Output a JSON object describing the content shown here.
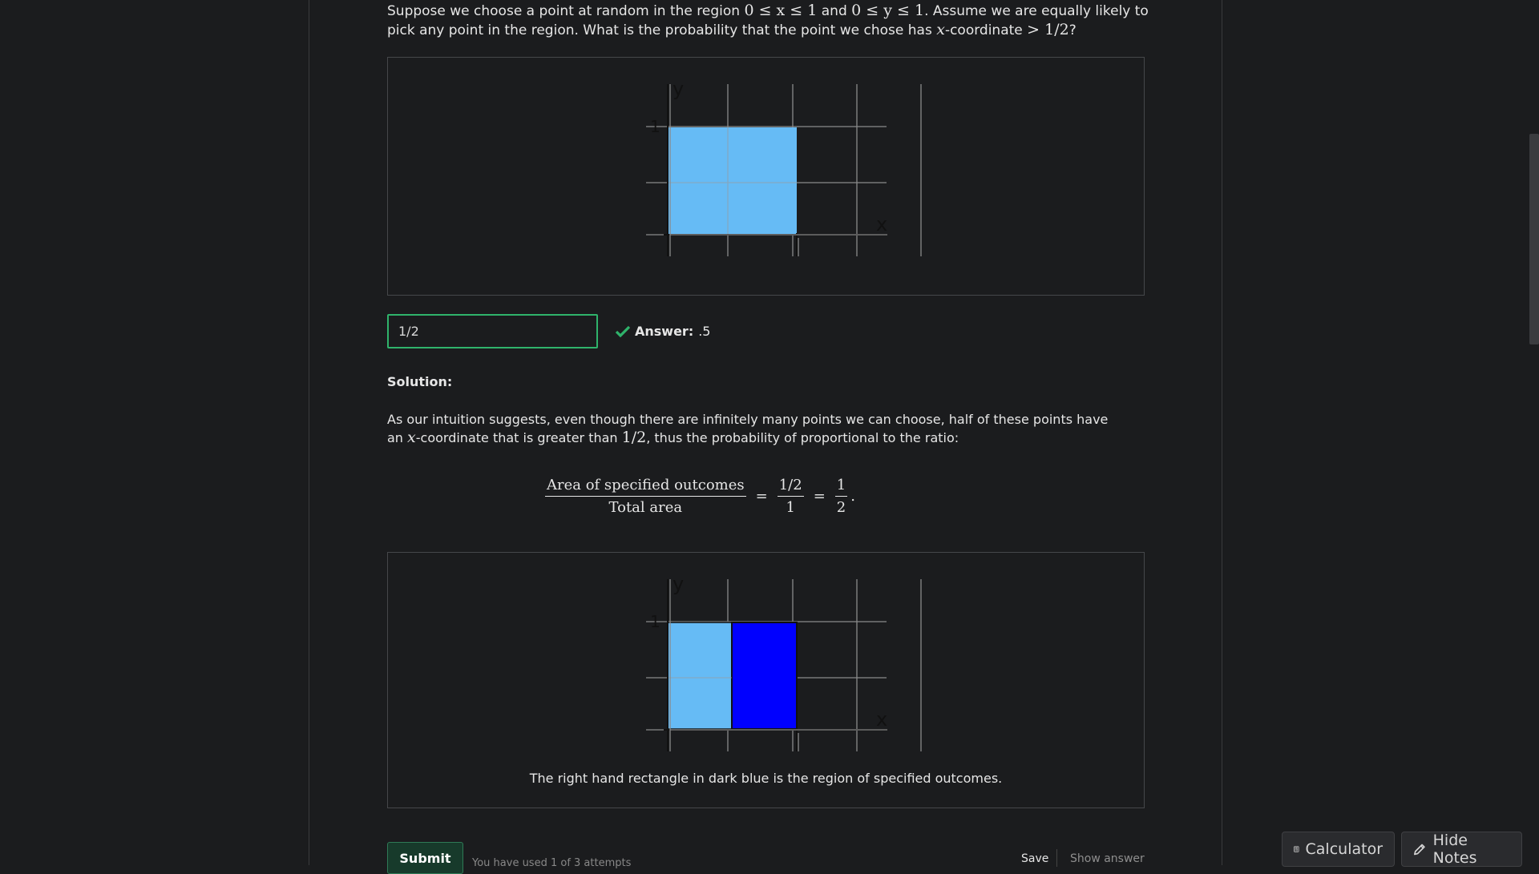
{
  "question": {
    "t1": "Suppose we choose a point at random in the region ",
    "m1": "0 ≤ x ≤ 1",
    "t2": " and ",
    "m2": "0 ≤ y ≤ 1",
    "t3": ". Assume we are equally likely to pick any point in the region. What is the probability that the point we chose has ",
    "m3": "x",
    "t4": "-coordinate ",
    "m4": "> 1/2",
    "t5": "?"
  },
  "figure1": {
    "y_label": "y",
    "x_label": "x",
    "tick_1": "1"
  },
  "answer_input": {
    "value": "1/2"
  },
  "answer_status": {
    "label": "Answer:",
    "value": ".5"
  },
  "solution": {
    "label": "Solution:",
    "t1": "As our intuition suggests, even though there are infinitely many points we can choose, half of these points have an ",
    "m1": "x",
    "t2": "-coordinate that is greater than ",
    "m2": "1/2",
    "t3": ", thus the probability of proportional to the ratio:"
  },
  "equation": {
    "num1": "Area of specified outcomes",
    "den1": "Total area",
    "num2": "1/2",
    "den2": "1",
    "num3": "1",
    "den3": "2",
    "eq": "=",
    "end": "."
  },
  "figure2": {
    "y_label": "y",
    "x_label": "x",
    "tick_1": "1",
    "caption": "The right hand rectangle in dark blue is the region of specified outcomes."
  },
  "footer": {
    "submit": "Submit",
    "attempts": "You have used 1 of 3 attempts",
    "save": "Save",
    "show_answer": "Show answer"
  },
  "tools": {
    "calculator": "Calculator",
    "hide_notes": "Hide Notes"
  },
  "colors": {
    "light_blue": "#66bbf5",
    "dark_blue": "#0000ff",
    "success": "#2fb36b"
  }
}
